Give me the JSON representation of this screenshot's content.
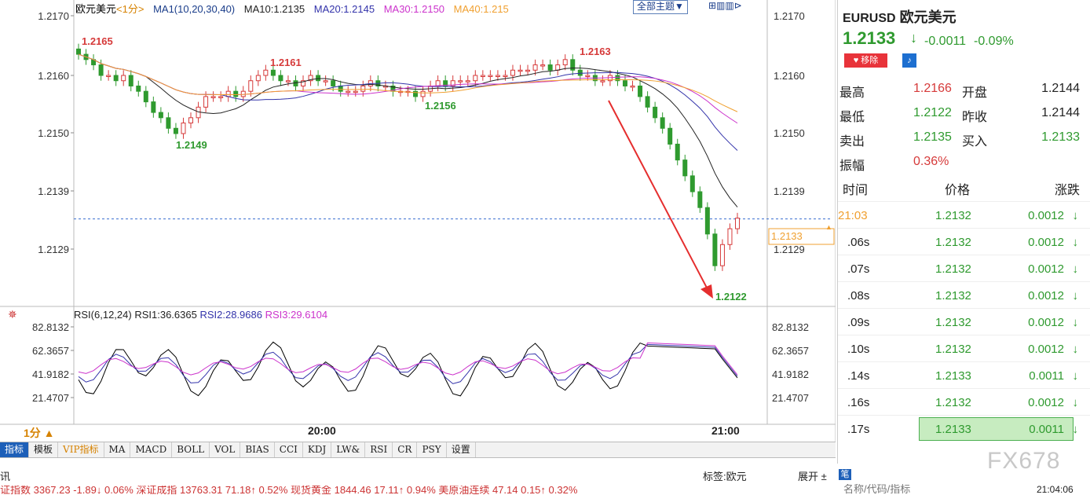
{
  "header": {
    "title": "欧元美元",
    "period": "<1分>",
    "ma_label": "MA1(10,20,30,40)",
    "ma10": "MA10:1.2135",
    "ma20": "MA20:1.2145",
    "ma30": "MA30:1.2150",
    "ma40": "MA40:1.215",
    "theme_button": "全部主题▼"
  },
  "price_axis": {
    "labels": [
      "1.2170",
      "1.2160",
      "1.2150",
      "1.2139",
      "1.2129"
    ]
  },
  "chart_annotations": {
    "high1": "1.2165",
    "low1": "1.2149",
    "high2": "1.2161",
    "low2": "1.2156",
    "high3": "1.2163",
    "low3": "1.2122",
    "current": "1.2133"
  },
  "rsi": {
    "label": "RSI(6,12,24)",
    "rsi1": "RSI1:36.6365",
    "rsi2": "RSI2:28.9686",
    "rsi3": "RSI3:29.6104",
    "axis": [
      "82.8132",
      "62.3657",
      "41.9182",
      "21.4707"
    ]
  },
  "time_axis": {
    "period": "1分 ▲",
    "labels": [
      "20:00",
      "21:00"
    ]
  },
  "tabs": [
    {
      "label": "指标"
    },
    {
      "label": "模板"
    },
    {
      "label": "VIP指标"
    },
    {
      "label": "MA"
    },
    {
      "label": "MACD"
    },
    {
      "label": "BOLL"
    },
    {
      "label": "VOL"
    },
    {
      "label": "BIAS"
    },
    {
      "label": "CCI"
    },
    {
      "label": "KDJ"
    },
    {
      "label": "LW&"
    },
    {
      "label": "RSI"
    },
    {
      "label": "CR"
    },
    {
      "label": "PSY"
    },
    {
      "label": "设置"
    }
  ],
  "info_bar": {
    "left": "讯",
    "tag": "标签:欧元",
    "expand": "展开 ±"
  },
  "status": {
    "text": "证指数  3367.23  -1.89↓ 0.06%    深证成指  13763.31  71.18↑ 0.52%    现货黄金  1844.46  17.11↑ 0.94%    美原油连续  47.14  0.15↑ 0.32%"
  },
  "quote": {
    "symbol": "EURUSD",
    "name": "欧元美元",
    "price": "1.2133",
    "change": "-0.0011",
    "pct": "-0.09%",
    "remove": "移除",
    "stats": [
      {
        "k": "最高",
        "v": "1.2166",
        "k2": "开盘",
        "v2": "1.2144"
      },
      {
        "k": "最低",
        "v": "1.2122",
        "k2": "昨收",
        "v2": "1.2144"
      },
      {
        "k": "卖出",
        "v": "1.2135",
        "k2": "买入",
        "v2": "1.2133"
      },
      {
        "k": "振幅",
        "v": "0.36%",
        "k2": "",
        "v2": ""
      }
    ],
    "ticks_header": {
      "time": "时间",
      "price": "价格",
      "change": "涨跌"
    },
    "ticks": [
      {
        "t": "21:03",
        "p": "1.2132",
        "c": "0.0012"
      },
      {
        "t": ".06s",
        "p": "1.2132",
        "c": "0.0012"
      },
      {
        "t": ".07s",
        "p": "1.2132",
        "c": "0.0012"
      },
      {
        "t": ".08s",
        "p": "1.2132",
        "c": "0.0012"
      },
      {
        "t": ".09s",
        "p": "1.2132",
        "c": "0.0012"
      },
      {
        "t": ".10s",
        "p": "1.2132",
        "c": "0.0012"
      },
      {
        "t": ".14s",
        "p": "1.2133",
        "c": "0.0011"
      },
      {
        "t": ".16s",
        "p": "1.2132",
        "c": "0.0012"
      },
      {
        "t": ".17s",
        "p": "1.2133",
        "c": "0.0011"
      }
    ],
    "search_placeholder": "名称/代码/指标",
    "clock": "21:04:06",
    "watermark": "FX678",
    "footer_tab": "笔"
  },
  "colors": {
    "up": "#d63a3a",
    "down": "#2f9a2f",
    "ma10": "#222222",
    "ma20": "#3333aa",
    "ma30": "#cc33cc",
    "ma40": "#f0a030",
    "accent": "#1d5fb8"
  }
}
